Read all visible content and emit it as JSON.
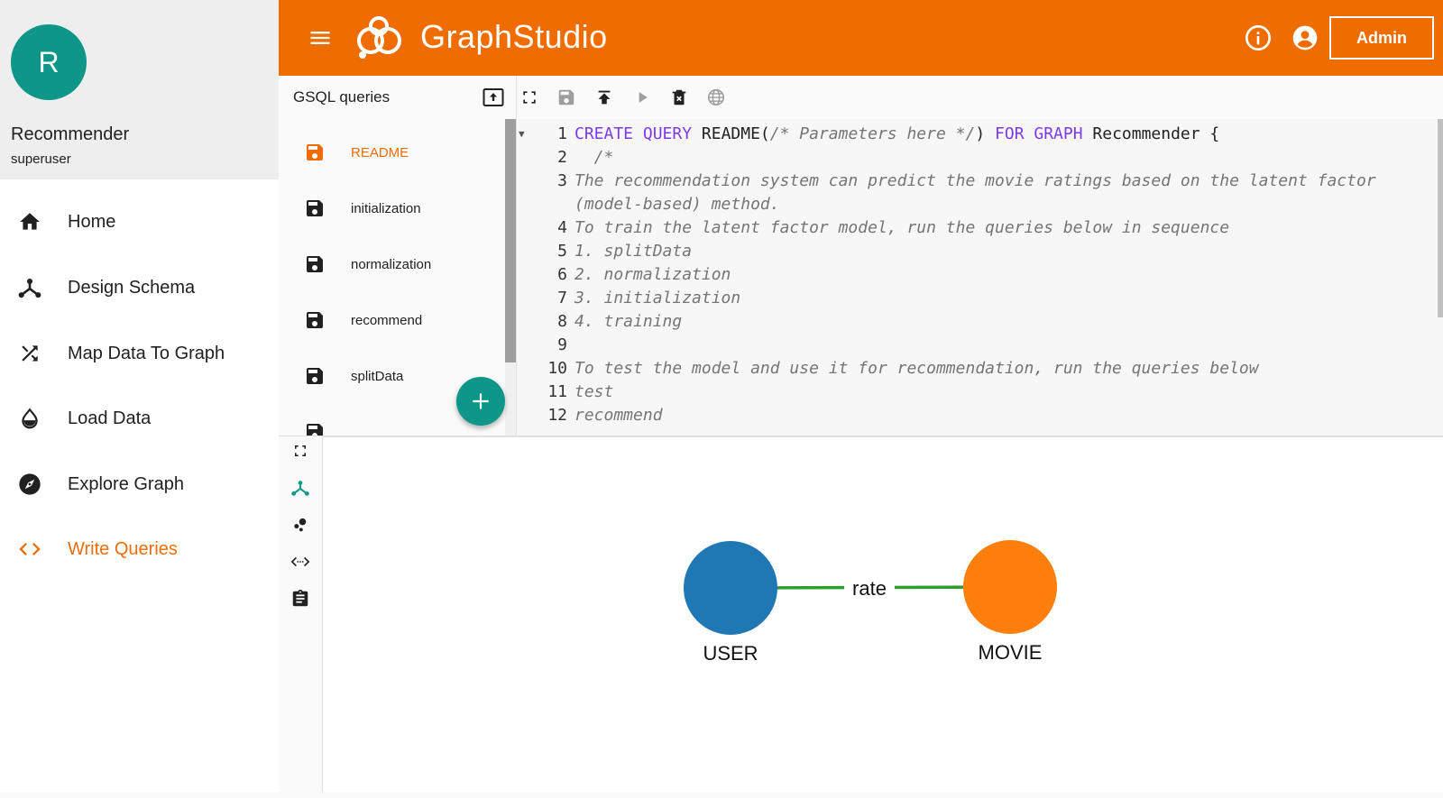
{
  "profile": {
    "avatar_letter": "R",
    "graph_name": "Recommender",
    "user": "superuser"
  },
  "nav": [
    {
      "label": "Home",
      "icon": "home-icon"
    },
    {
      "label": "Design Schema",
      "icon": "schema-icon"
    },
    {
      "label": "Map Data To Graph",
      "icon": "shuffle-icon"
    },
    {
      "label": "Load Data",
      "icon": "drop-icon"
    },
    {
      "label": "Explore Graph",
      "icon": "compass-icon"
    },
    {
      "label": "Write Queries",
      "icon": "code-icon",
      "active": true
    }
  ],
  "header": {
    "logo_bold": "Graph",
    "logo_thin": "Studio",
    "admin_label": "Admin",
    "bg_color": "#ef6c00"
  },
  "query_panel": {
    "title": "GSQL queries",
    "queries": [
      "README",
      "initialization",
      "normalization",
      "recommend",
      "splitData"
    ],
    "active": "README"
  },
  "editor": {
    "lines": [
      {
        "n": "1",
        "parts": [
          [
            "kw",
            "CREATE QUERY "
          ],
          [
            "",
            "README("
          ],
          [
            "cm",
            "/* Parameters here */"
          ],
          [
            "",
            ") "
          ],
          [
            "kw",
            "FOR GRAPH "
          ],
          [
            "",
            "Recommender {"
          ]
        ]
      },
      {
        "n": "2",
        "parts": [
          [
            "cm",
            "  /*"
          ]
        ]
      },
      {
        "n": "3",
        "parts": [
          [
            "cm",
            "The recommendation system can predict the movie ratings based on the latent factor"
          ]
        ]
      },
      {
        "n": "",
        "parts": [
          [
            "cm",
            "(model-based) method."
          ]
        ]
      },
      {
        "n": "4",
        "parts": [
          [
            "cm",
            "To train the latent factor model, run the queries below in sequence"
          ]
        ]
      },
      {
        "n": "5",
        "parts": [
          [
            "cm",
            "1. splitData"
          ]
        ]
      },
      {
        "n": "6",
        "parts": [
          [
            "cm",
            "2. normalization"
          ]
        ]
      },
      {
        "n": "7",
        "parts": [
          [
            "cm",
            "3. initialization"
          ]
        ]
      },
      {
        "n": "8",
        "parts": [
          [
            "cm",
            "4. training"
          ]
        ]
      },
      {
        "n": "9",
        "parts": [
          [
            "cm",
            ""
          ]
        ]
      },
      {
        "n": "10",
        "parts": [
          [
            "cm",
            "To test the model and use it for recommendation, run the queries below"
          ]
        ]
      },
      {
        "n": "11",
        "parts": [
          [
            "cm",
            "test"
          ]
        ]
      },
      {
        "n": "12",
        "parts": [
          [
            "cm",
            "recommend"
          ]
        ]
      }
    ]
  },
  "schema_graph": {
    "vertices": [
      {
        "label": "USER",
        "color": "#1f77b4"
      },
      {
        "label": "MOVIE",
        "color": "#ff7f0e"
      }
    ],
    "edge": {
      "label": "rate",
      "color": "#2ca02c"
    }
  }
}
